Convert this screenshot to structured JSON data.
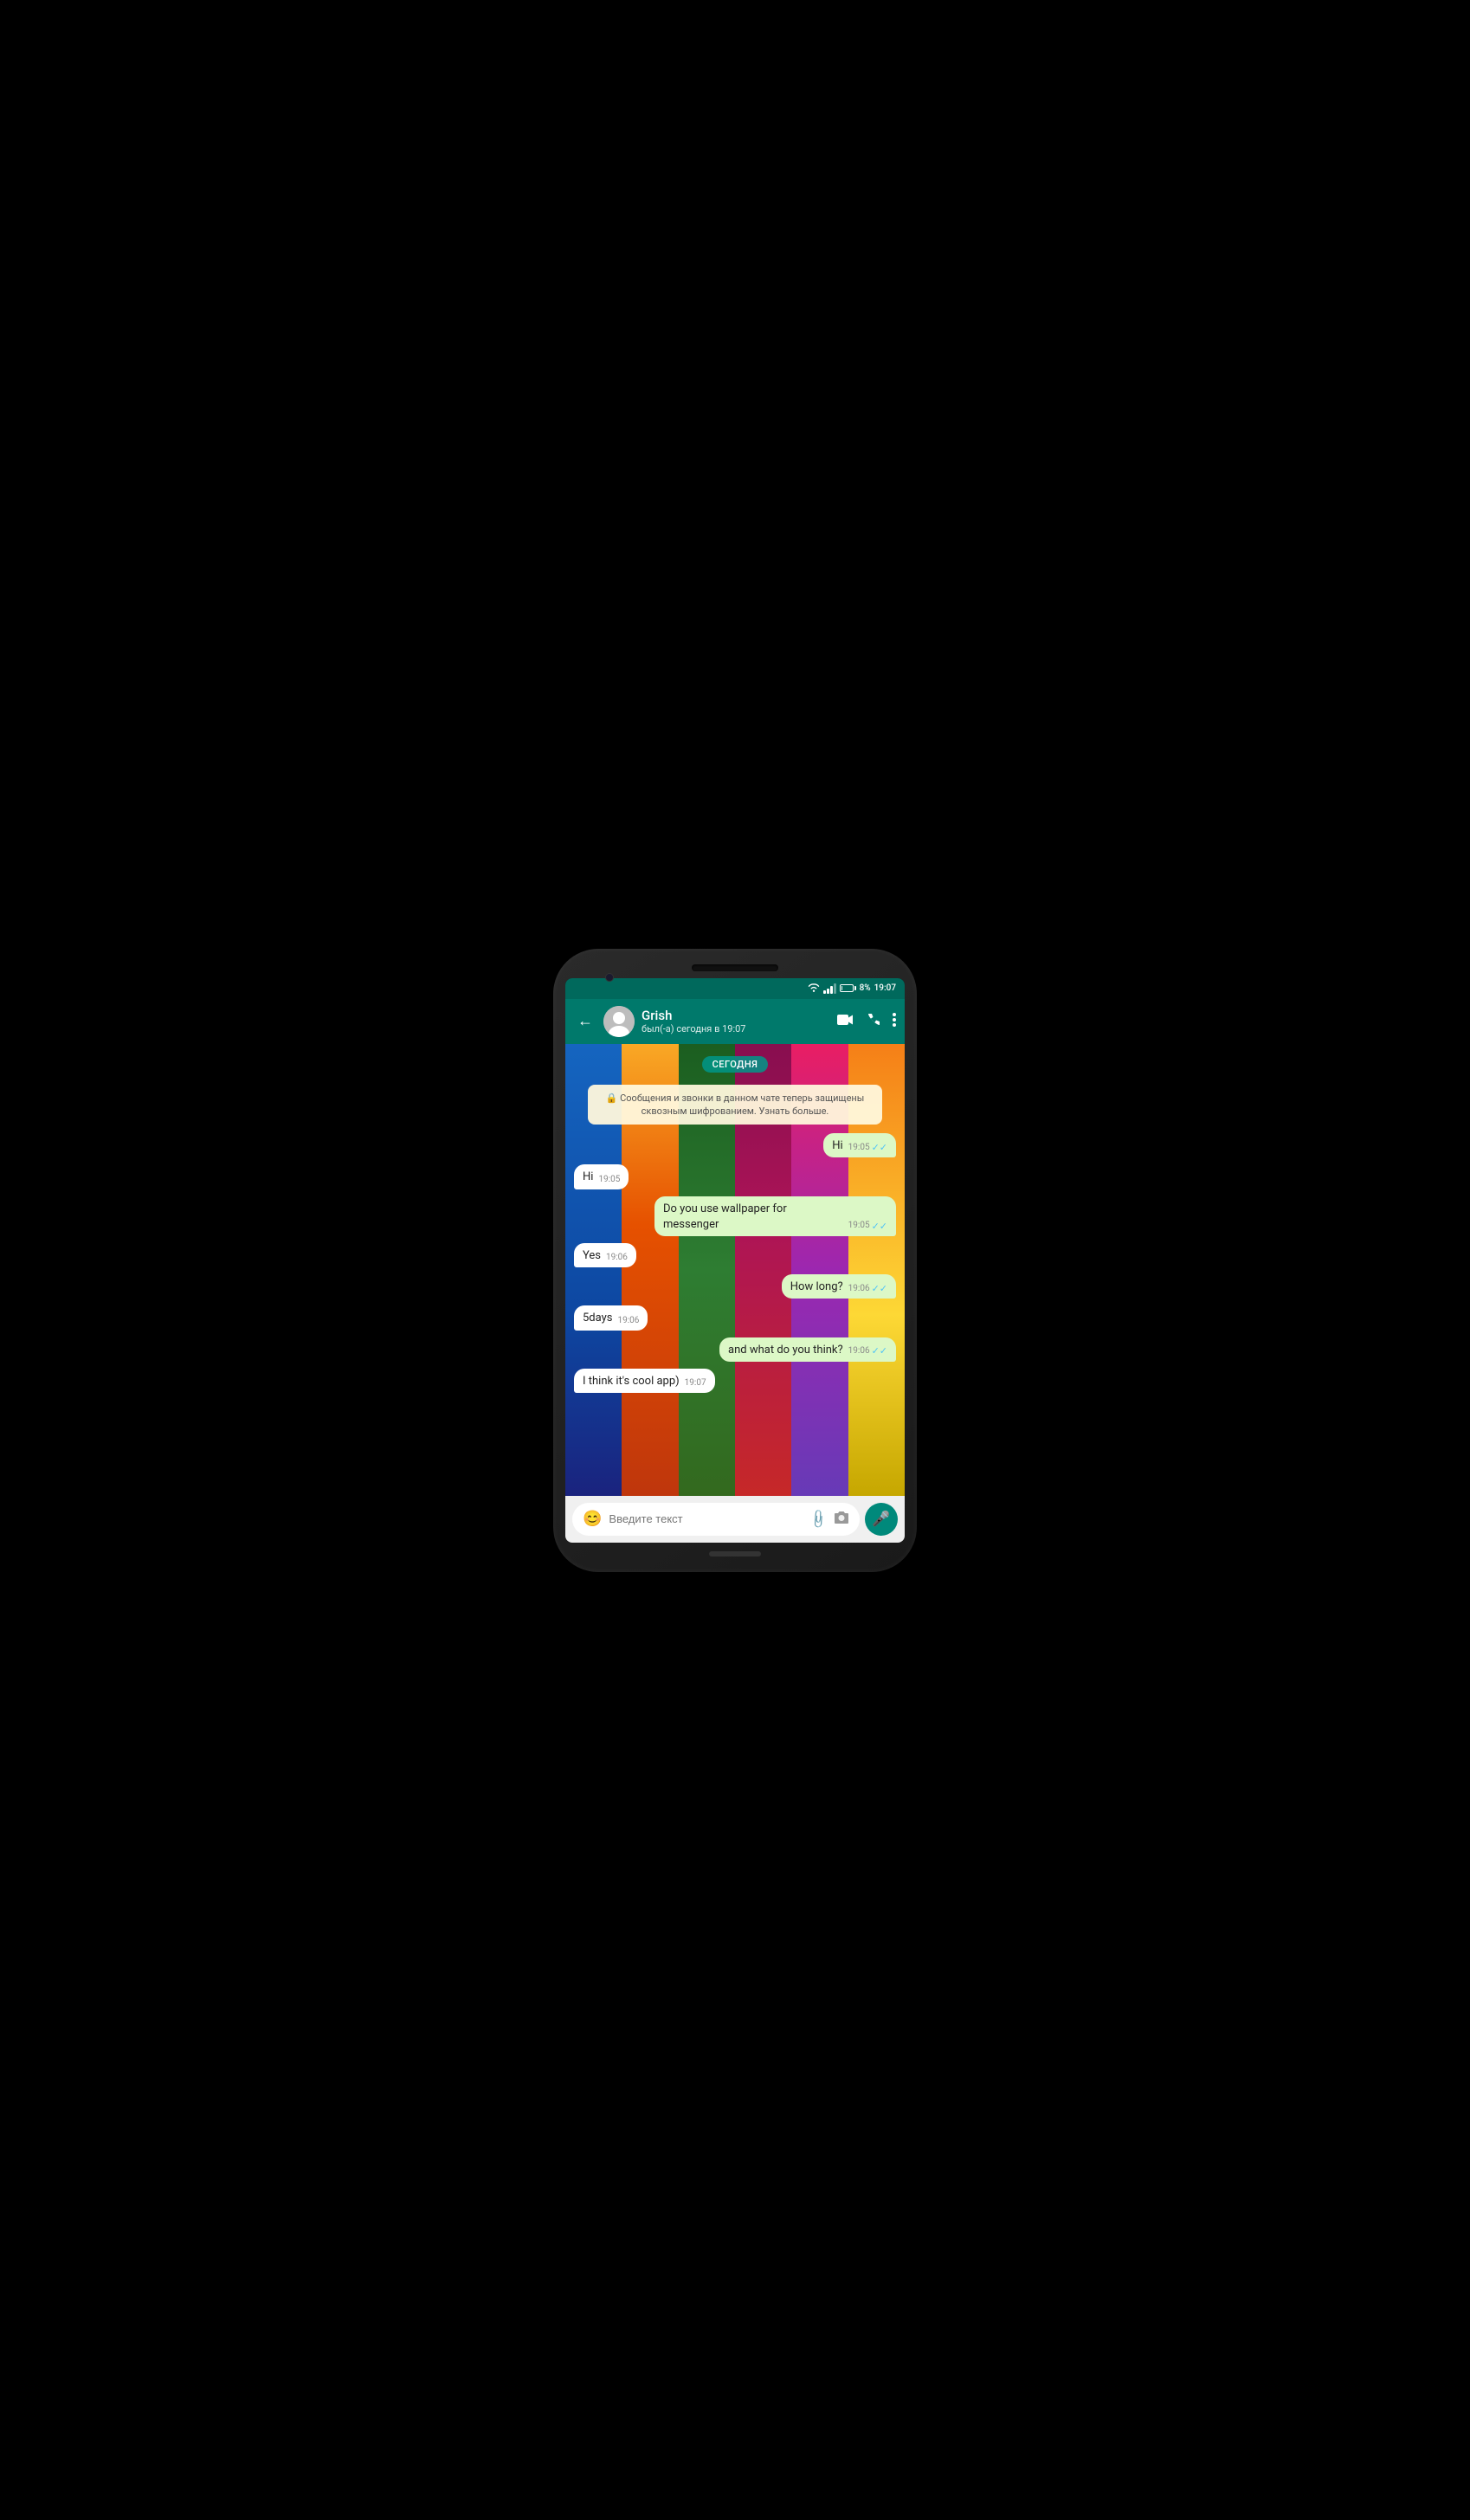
{
  "statusBar": {
    "wifi": "wifi",
    "signal": "signal",
    "battery": "8%",
    "time": "19:07"
  },
  "header": {
    "backLabel": "←",
    "contactName": "Grish",
    "contactStatus": "был(-а) сегодня в 19:07",
    "videoIcon": "video",
    "callIcon": "call",
    "moreIcon": "more"
  },
  "chat": {
    "dateBadge": "СЕГОДНЯ",
    "systemMessage": "🔒 Сообщения и звонки в данном чате теперь защищены сквозным шифрованием. Узнать больше.",
    "messages": [
      {
        "id": 1,
        "text": "Hi",
        "time": "19:05",
        "type": "sent",
        "checks": "✓✓"
      },
      {
        "id": 2,
        "text": "Hi",
        "time": "19:05",
        "type": "received",
        "checks": ""
      },
      {
        "id": 3,
        "text": "Do you use wallpaper for messenger",
        "time": "19:05",
        "type": "sent",
        "checks": "✓✓"
      },
      {
        "id": 4,
        "text": "Yes",
        "time": "19:06",
        "type": "received",
        "checks": ""
      },
      {
        "id": 5,
        "text": "How long?",
        "time": "19:06",
        "type": "sent",
        "checks": "✓✓"
      },
      {
        "id": 6,
        "text": "5days",
        "time": "19:06",
        "type": "received",
        "checks": ""
      },
      {
        "id": 7,
        "text": "and what do you think?",
        "time": "19:06",
        "type": "sent",
        "checks": "✓✓"
      },
      {
        "id": 8,
        "text": "I think it's cool app)",
        "time": "19:07",
        "type": "received",
        "checks": ""
      }
    ]
  },
  "inputBar": {
    "placeholder": "Введите текст",
    "emojiIcon": "😊",
    "attachIcon": "📎",
    "cameraIcon": "📷",
    "micIcon": "🎤"
  }
}
